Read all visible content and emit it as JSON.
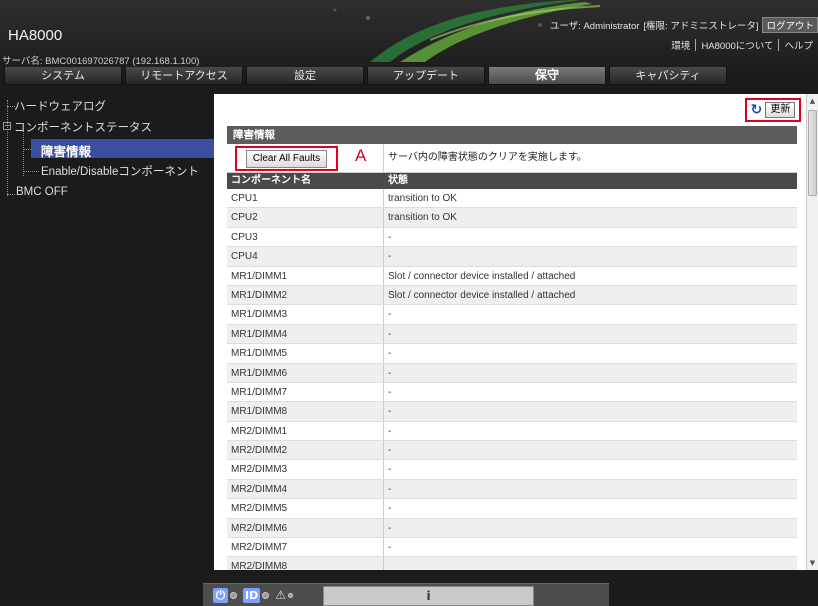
{
  "header": {
    "app_title": "HA8000",
    "server_name": "サーバ名: BMC001697026787 (192.168.1.100)",
    "user_label": "ユーザ: Administrator",
    "role_label": "[権限: アドミニストレータ]",
    "logout": "ログアウト",
    "links": [
      "環境",
      "HA8000について",
      "ヘルプ"
    ]
  },
  "tabs": [
    {
      "label": "システム",
      "active": false
    },
    {
      "label": "リモートアクセス",
      "active": false
    },
    {
      "label": "設定",
      "active": false
    },
    {
      "label": "アップデート",
      "active": false
    },
    {
      "label": "保守",
      "active": true
    },
    {
      "label": "キャパシティ",
      "active": false
    }
  ],
  "nav": {
    "items": [
      {
        "label": "ハードウェアログ"
      },
      {
        "label": "コンポーネントステータス"
      },
      {
        "label": "障害情報",
        "selected": true
      },
      {
        "label": "Enable/Disableコンポーネント"
      },
      {
        "label": "BMC OFF"
      }
    ]
  },
  "toolbar": {
    "refresh_icon": "refresh-icon",
    "refresh_label": "更新"
  },
  "panel": {
    "title": "障害情報",
    "clear_button": "Clear All Faults",
    "annotation": "A",
    "clear_description": "サーバ内の障害状態のクリアを実施します。",
    "columns": [
      "コンポーネント名",
      "状態"
    ],
    "rows": [
      [
        "CPU1",
        "transition to OK"
      ],
      [
        "CPU2",
        "transition to OK"
      ],
      [
        "CPU3",
        "-"
      ],
      [
        "CPU4",
        "-"
      ],
      [
        "MR1/DIMM1",
        "Slot / connector device installed / attached"
      ],
      [
        "MR1/DIMM2",
        "Slot / connector device installed / attached"
      ],
      [
        "MR1/DIMM3",
        "-"
      ],
      [
        "MR1/DIMM4",
        "-"
      ],
      [
        "MR1/DIMM5",
        "-"
      ],
      [
        "MR1/DIMM6",
        "-"
      ],
      [
        "MR1/DIMM7",
        "-"
      ],
      [
        "MR1/DIMM8",
        "-"
      ],
      [
        "MR2/DIMM1",
        "-"
      ],
      [
        "MR2/DIMM2",
        "-"
      ],
      [
        "MR2/DIMM3",
        "-"
      ],
      [
        "MR2/DIMM4",
        "-"
      ],
      [
        "MR2/DIMM5",
        "-"
      ],
      [
        "MR2/DIMM6",
        "-"
      ],
      [
        "MR2/DIMM7",
        "-"
      ],
      [
        "MR2/DIMM8",
        ""
      ]
    ]
  },
  "status_bar": {
    "icons": [
      "power-icon",
      "id-icon",
      "warning-icon"
    ],
    "id_label": "ID",
    "info_label": "i"
  },
  "colors": {
    "selected_nav": "#3a4fa0",
    "highlight_box": "#e0001a",
    "status_icon": "#7ea0ff"
  }
}
